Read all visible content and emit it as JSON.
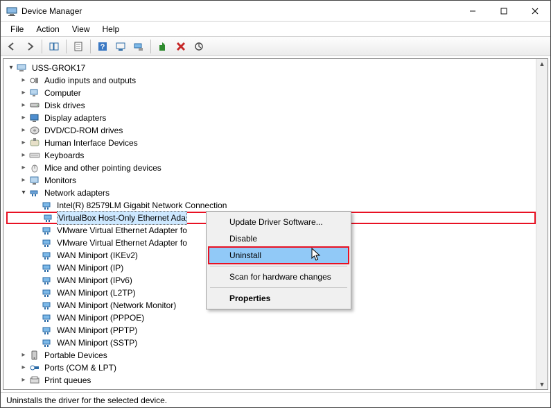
{
  "window": {
    "title": "Device Manager"
  },
  "menu": {
    "file": "File",
    "action": "Action",
    "view": "View",
    "help": "Help"
  },
  "toolbar_icons": {
    "back": "back-icon",
    "forward": "forward-icon",
    "showhide": "showhide-icon",
    "properties": "properties-icon",
    "help": "help-icon",
    "refresh": "refresh-icon",
    "monitor": "monitor-icon",
    "install": "install-icon",
    "uninstall": "uninstall-icon",
    "scan": "scan-icon"
  },
  "tree": {
    "root": "USS-GROK17",
    "categories": [
      "Audio inputs and outputs",
      "Computer",
      "Disk drives",
      "Display adapters",
      "DVD/CD-ROM drives",
      "Human Interface Devices",
      "Keyboards",
      "Mice and other pointing devices",
      "Monitors",
      "Network adapters",
      "Portable Devices",
      "Ports (COM & LPT)",
      "Print queues"
    ],
    "network_children": [
      "Intel(R) 82579LM Gigabit Network Connection",
      "VirtualBox Host-Only Ethernet Ada",
      "VMware Virtual Ethernet Adapter fo",
      "VMware Virtual Ethernet Adapter fo",
      "WAN Miniport (IKEv2)",
      "WAN Miniport (IP)",
      "WAN Miniport (IPv6)",
      "WAN Miniport (L2TP)",
      "WAN Miniport (Network Monitor)",
      "WAN Miniport (PPPOE)",
      "WAN Miniport (PPTP)",
      "WAN Miniport (SSTP)"
    ]
  },
  "contextmenu": {
    "update": "Update Driver Software...",
    "disable": "Disable",
    "uninstall": "Uninstall",
    "scan": "Scan for hardware changes",
    "properties": "Properties"
  },
  "statusbar": {
    "text": "Uninstalls the driver for the selected device."
  }
}
